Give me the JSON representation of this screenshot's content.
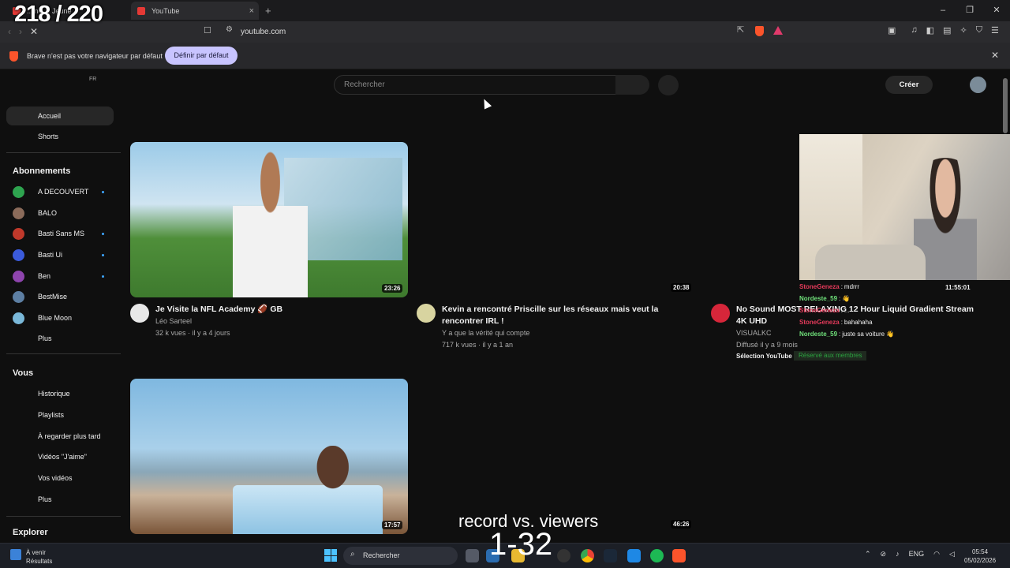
{
  "overlay": {
    "counter": "218 / 220",
    "record_label": "record vs. viewers",
    "record_value": "1-32"
  },
  "browser": {
    "tab1_title": "...ine ... Jeune",
    "tab2_title": "YouTube",
    "tab_close": "×",
    "new_tab": "+",
    "window_controls": [
      "–",
      "❐",
      "✕"
    ],
    "url": "youtube.com",
    "infobar_text": "Brave n'est pas votre navigateur par défaut",
    "infobar_button": "Définir par défaut",
    "infobar_close": "✕",
    "accent": "#fb542b"
  },
  "youtube": {
    "lang_label": "FR",
    "search_placeholder": "Rechercher",
    "create_label": "Créer",
    "sidebar": {
      "home": "Accueil",
      "shorts": "Shorts",
      "subs_heading": "Abonnements",
      "subs": [
        {
          "name": "A DECOUVERT",
          "color": "#2ea44f",
          "new": true
        },
        {
          "name": "BALO",
          "color": "#8b6b5a",
          "new": false
        },
        {
          "name": "Basti Sans MS",
          "color": "#c0392b",
          "new": true
        },
        {
          "name": "Basti Ui",
          "color": "#3b5bdb",
          "new": true
        },
        {
          "name": "Ben",
          "color": "#8e44ad",
          "new": true
        },
        {
          "name": "BestMise",
          "color": "#5d7fa3",
          "new": false
        },
        {
          "name": "Blue Moon",
          "color": "#7ab8d9",
          "new": false
        }
      ],
      "subs_more": "Plus",
      "you_heading": "Vous",
      "you_items": [
        "Historique",
        "Playlists",
        "À regarder plus tard",
        "Vidéos \"J'aime\"",
        "Vos vidéos",
        "Plus"
      ],
      "explore_heading": "Explorer"
    },
    "videos": [
      {
        "title": "Je Visite la NFL Academy 🏈 GB",
        "channel": "Léo Sarteel",
        "meta": "32 k vues · il y a 4 jours",
        "duration": "23:26"
      },
      {
        "title": "Kevin a rencontré Priscille sur les réseaux mais veut la rencontrer IRL !",
        "channel": "Y a que la vérité qui compte",
        "meta": "717 k vues · il y a 1 an",
        "duration": "20:38"
      },
      {
        "title": "No Sound MOST RELAXING 12 Hour Liquid Gradient Stream 4K UHD",
        "channel": "VISUALKC",
        "meta": "Diffusé il y a 9 mois",
        "badge1": "Sélection YouTube",
        "badge2": "Réservé aux membres",
        "duration": ""
      },
      {
        "duration": "17:57"
      },
      {
        "duration": "46:26"
      }
    ]
  },
  "stream": {
    "time": "11:55:01",
    "chat": [
      {
        "user": "StoneGeneza",
        "msg": "mdrrr",
        "color": "#e33a5a"
      },
      {
        "user": "Nordeste_59",
        "msg": "👋",
        "color": "#6fe07a"
      },
      {
        "user": "StoneGeneza",
        "msg": "...",
        "color": "#e33a5a"
      },
      {
        "user": "StoneGeneza",
        "msg": "bahahaha",
        "color": "#e33a5a"
      },
      {
        "user": "Nordeste_59",
        "msg": "juste sa voiture 👋",
        "color": "#6fe07a"
      }
    ]
  },
  "taskbar": {
    "weather_title": "À venir",
    "weather_sub": "Résultats",
    "search": "Rechercher",
    "lang": "ENG",
    "time": "05:54",
    "date": "05/02/2026"
  }
}
